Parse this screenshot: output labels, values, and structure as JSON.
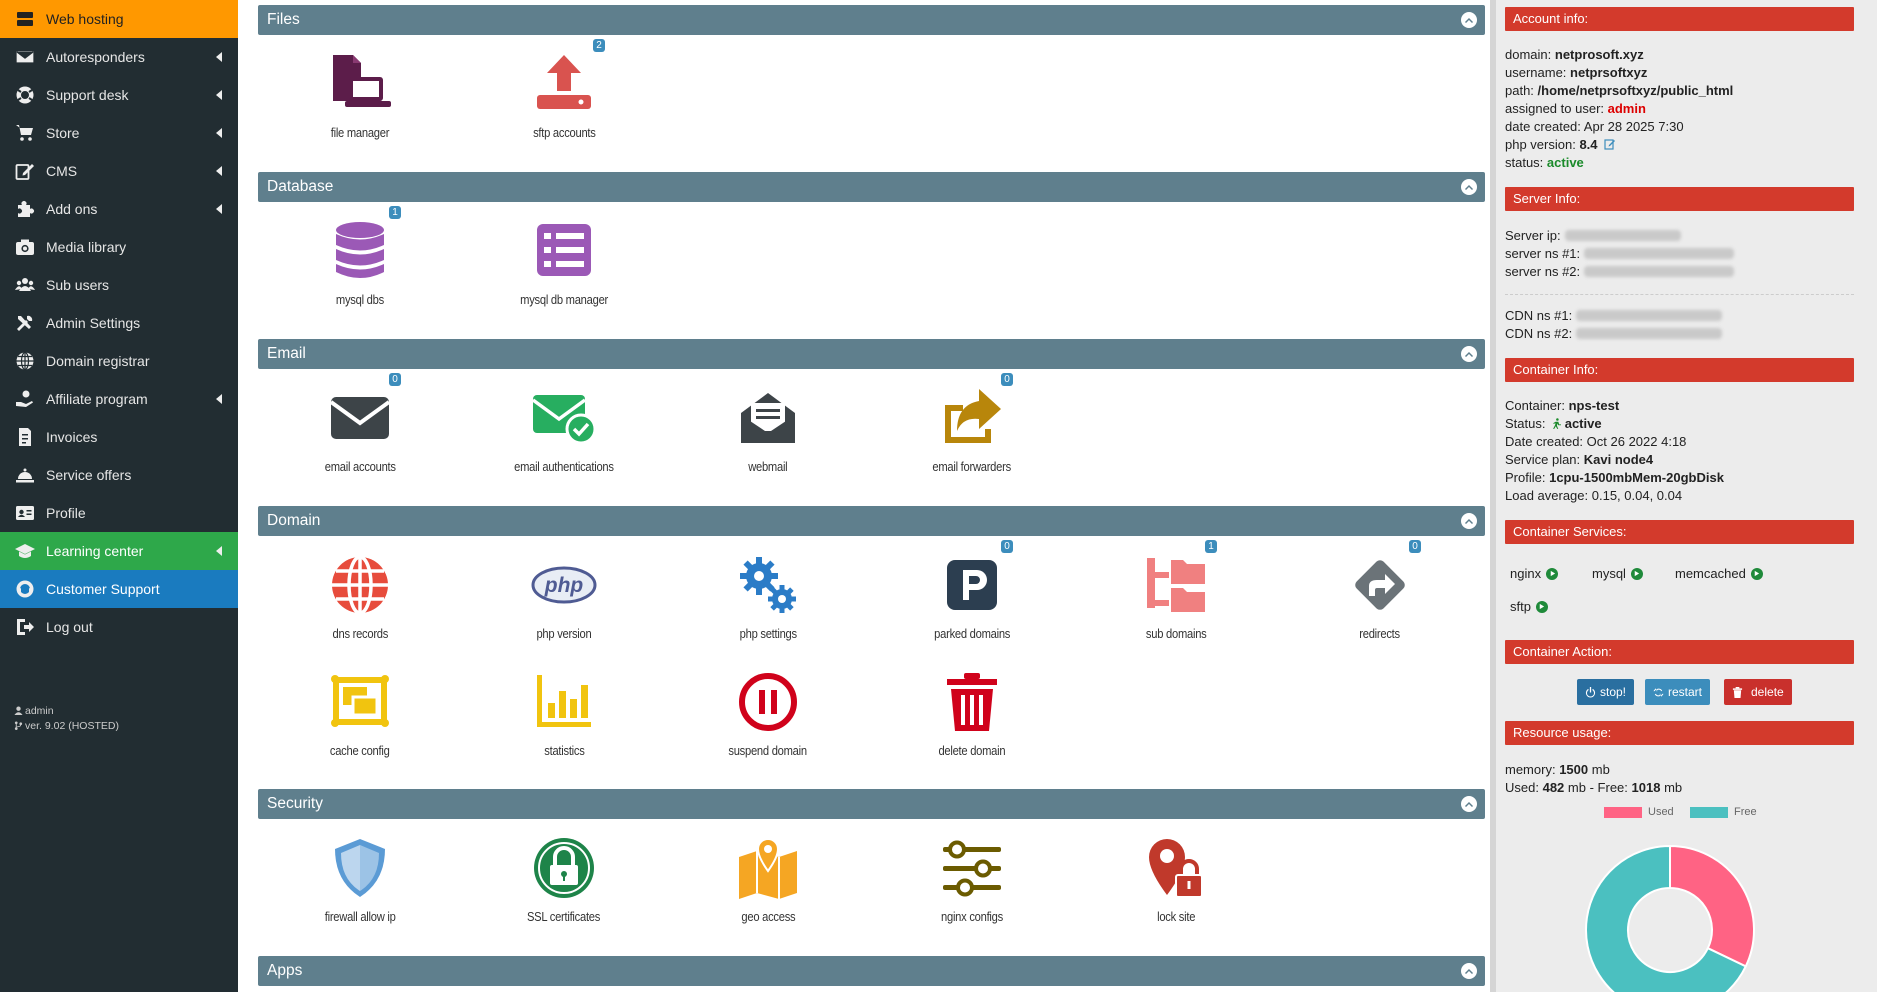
{
  "sidebar": {
    "items": [
      {
        "label": "Web hosting",
        "icon": "server-icon",
        "caret": false,
        "state": "orange"
      },
      {
        "label": "Autoresponders",
        "icon": "envelope-icon",
        "caret": true,
        "state": ""
      },
      {
        "label": "Support desk",
        "icon": "lifebuoy-icon",
        "caret": true,
        "state": ""
      },
      {
        "label": "Store",
        "icon": "cart-icon",
        "caret": true,
        "state": ""
      },
      {
        "label": "CMS",
        "icon": "edit-icon",
        "caret": true,
        "state": ""
      },
      {
        "label": "Add ons",
        "icon": "puzzle-icon",
        "caret": true,
        "state": ""
      },
      {
        "label": "Media library",
        "icon": "camera-icon",
        "caret": false,
        "state": ""
      },
      {
        "label": "Sub users",
        "icon": "users-icon",
        "caret": false,
        "state": ""
      },
      {
        "label": "Admin Settings",
        "icon": "tools-icon",
        "caret": false,
        "state": ""
      },
      {
        "label": "Domain registrar",
        "icon": "globe-icon",
        "caret": false,
        "state": ""
      },
      {
        "label": "Affiliate program",
        "icon": "hand-coin-icon",
        "caret": true,
        "state": ""
      },
      {
        "label": "Invoices",
        "icon": "invoice-icon",
        "caret": false,
        "state": ""
      },
      {
        "label": "Service offers",
        "icon": "bell-icon",
        "caret": false,
        "state": ""
      },
      {
        "label": "Profile",
        "icon": "id-card-icon",
        "caret": false,
        "state": ""
      },
      {
        "label": "Learning center",
        "icon": "graduation-cap-icon",
        "caret": true,
        "state": "green"
      },
      {
        "label": "Customer Support",
        "icon": "headset-icon",
        "caret": false,
        "state": "blue"
      },
      {
        "label": "Log out",
        "icon": "logout-icon",
        "caret": false,
        "state": ""
      }
    ],
    "footer_user": "admin",
    "footer_version": "ver. 9.02 (HOSTED)"
  },
  "sections": {
    "files": {
      "title": "Files",
      "tiles": [
        {
          "label": "file manager",
          "badge": ""
        },
        {
          "label": "sftp accounts",
          "badge": "2"
        }
      ]
    },
    "database": {
      "title": "Database",
      "tiles": [
        {
          "label": "mysql dbs",
          "badge": "1"
        },
        {
          "label": "mysql db manager",
          "badge": ""
        }
      ]
    },
    "email": {
      "title": "Email",
      "tiles": [
        {
          "label": "email accounts",
          "badge": "0"
        },
        {
          "label": "email authentications",
          "badge": ""
        },
        {
          "label": "webmail",
          "badge": ""
        },
        {
          "label": "email forwarders",
          "badge": "0"
        }
      ]
    },
    "domain": {
      "title": "Domain",
      "tiles": [
        {
          "label": "dns records",
          "badge": ""
        },
        {
          "label": "php version",
          "badge": ""
        },
        {
          "label": "php settings",
          "badge": ""
        },
        {
          "label": "parked domains",
          "badge": "0"
        },
        {
          "label": "sub domains",
          "badge": "1"
        },
        {
          "label": "redirects",
          "badge": "0"
        },
        {
          "label": "cache config",
          "badge": ""
        },
        {
          "label": "statistics",
          "badge": ""
        },
        {
          "label": "suspend domain",
          "badge": ""
        },
        {
          "label": "delete domain",
          "badge": ""
        }
      ]
    },
    "security": {
      "title": "Security",
      "tiles": [
        {
          "label": "firewall allow ip",
          "badge": ""
        },
        {
          "label": "SSL certificates",
          "badge": ""
        },
        {
          "label": "geo access",
          "badge": ""
        },
        {
          "label": "nginx configs",
          "badge": ""
        },
        {
          "label": "lock site",
          "badge": ""
        }
      ]
    },
    "apps": {
      "title": "Apps"
    }
  },
  "account": {
    "title": "Account info:",
    "domain_label": "domain:",
    "domain": "netprosoft.xyz",
    "username_label": "username:",
    "username": "netprsoftxyz",
    "path_label": "path:",
    "path": "/home/netprsoftxyz/public_html",
    "assigned_label": "assigned to user:",
    "assigned": "admin",
    "created_label": "date created:",
    "created": "Apr 28 2025 7:30",
    "php_label": "php version:",
    "php": "8.4",
    "status_label": "status:",
    "status": "active"
  },
  "server": {
    "title": "Server Info:",
    "ip_label": "Server ip:",
    "ns1_label": "server ns #1:",
    "ns2_label": "server ns #2:",
    "cdn1_label": "CDN ns #1:",
    "cdn2_label": "CDN ns #2:"
  },
  "container": {
    "title": "Container Info:",
    "name_label": "Container:",
    "name": "nps-test",
    "status_label": "Status:",
    "status": "active",
    "created_label": "Date created:",
    "created": "Oct 26 2022 4:18",
    "plan_label": "Service plan:",
    "plan": "Kavi node4",
    "profile_label": "Profile:",
    "profile": "1cpu-1500mbMem-20gbDisk",
    "load_label": "Load average:",
    "load": "0.15, 0.04, 0.04"
  },
  "services": {
    "title": "Container Services:",
    "items": [
      "nginx",
      "mysql",
      "memcached",
      "sftp"
    ]
  },
  "actions": {
    "title": "Container Action:",
    "stop": "stop!",
    "restart": "restart",
    "delete": "delete"
  },
  "resources": {
    "title": "Resource usage:",
    "memory_label": "memory:",
    "memory": "1500",
    "unit": "mb",
    "used_label": "Used:",
    "used": "482",
    "free_label": "- Free:",
    "free": "1018",
    "legend_used": "Used",
    "legend_free": "Free",
    "color_used": "#ff6384",
    "color_free": "#4bc0c0"
  },
  "chart_data": {
    "type": "pie",
    "categories": [
      "Used",
      "Free"
    ],
    "values": [
      482,
      1018
    ],
    "title": "",
    "legend": "top"
  }
}
